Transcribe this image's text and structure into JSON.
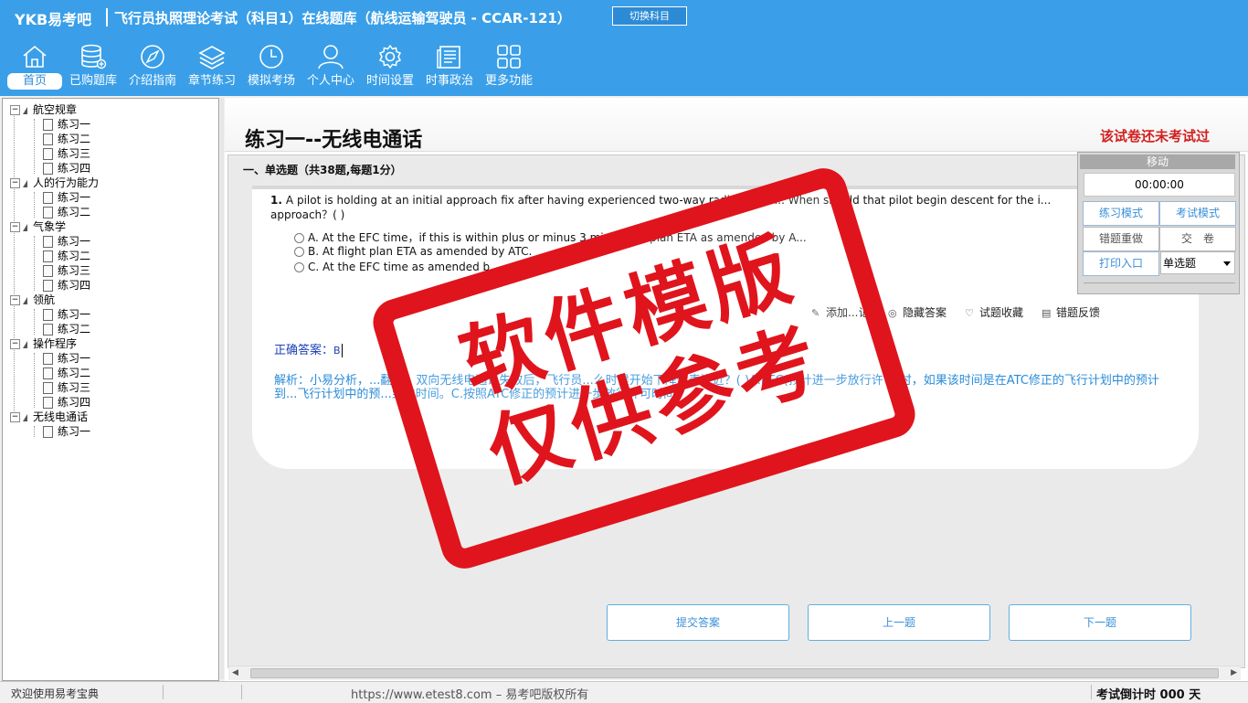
{
  "header": {
    "logo": "YKB易考吧",
    "title": "飞行员执照理论考试（科目1）在线题库（航线运输驾驶员 - CCAR-121）",
    "switch_label": "切换科目"
  },
  "nav": [
    {
      "label": "首页",
      "icon": "home-icon",
      "active": true
    },
    {
      "label": "已购题库",
      "icon": "database-icon"
    },
    {
      "label": "介绍指南",
      "icon": "compass-icon"
    },
    {
      "label": "章节练习",
      "icon": "layers-icon"
    },
    {
      "label": "模拟考场",
      "icon": "clock-icon"
    },
    {
      "label": "个人中心",
      "icon": "user-icon"
    },
    {
      "label": "时间设置",
      "icon": "gear-icon"
    },
    {
      "label": "时事政治",
      "icon": "news-icon"
    },
    {
      "label": "更多功能",
      "icon": "grid-icon"
    }
  ],
  "tree": [
    {
      "label": "航空规章",
      "children": [
        "练习一",
        "练习二",
        "练习三",
        "练习四"
      ]
    },
    {
      "label": "人的行为能力",
      "children": [
        "练习一",
        "练习二"
      ]
    },
    {
      "label": "气象学",
      "children": [
        "练习一",
        "练习二",
        "练习三",
        "练习四"
      ]
    },
    {
      "label": "领航",
      "children": [
        "练习一",
        "练习二"
      ]
    },
    {
      "label": "操作程序",
      "children": [
        "练习一",
        "练习二",
        "练习三",
        "练习四"
      ]
    },
    {
      "label": "无线电通话",
      "children": [
        "练习一"
      ]
    }
  ],
  "page": {
    "title": "练习一--无线电通话",
    "status": "该试卷还未考试过",
    "section": "一、单选题（共38题,每题1分）"
  },
  "question": {
    "number": "1.",
    "stem": "A pilot is holding at an initial approach fix after having experienced two-way radio comm... When should that pilot begin descent for the i... approach？( )",
    "options": [
      {
        "key": "A.",
        "text": "At the EFC time，if this is within plus or minus 3 minut... ... plan ETA as amended by A..."
      },
      {
        "key": "B.",
        "text": "At flight plan ETA as amended by ATC."
      },
      {
        "key": "C.",
        "text": "At the EFC time as amended b..."
      }
    ],
    "tools": [
      "添加...记",
      "隐藏答案",
      "试题收藏",
      "错题反馈"
    ],
    "answer_label": "正确答案：",
    "answer_value": "B",
    "analysis": "解析：小易分析，...翻译：双向无线电通讯失效后，飞行员...么时候开始下降仪表进近？( )A.EFC(预计进一步放行许可)时，如果该时间是在ATC修正的飞行计划中的预计到...飞行计划中的预...到达时间。C.按照ATC修正的预计进一步放行许可时间"
  },
  "actions": {
    "submit": "提交答案",
    "prev": "上一题",
    "next": "下一题"
  },
  "panel": {
    "move": "移动",
    "timer": "00:00:00",
    "practice_mode": "练习模式",
    "exam_mode": "考试模式",
    "redo_wrong": "错题重做",
    "hand_in": "交　卷",
    "print": "打印入口",
    "type_select": "单选题"
  },
  "status": {
    "welcome": "欢迎使用易考宝典",
    "copyright": "https://www.etest8.com – 易考吧版权所有",
    "countdown": "考试倒计时 000 天"
  },
  "watermark": {
    "line1": "软件模版",
    "line2": "仅供参考"
  },
  "colors": {
    "header": "#3a9fe8",
    "stamp": "#e0141c",
    "analysis": "#2a8cd8",
    "status_red": "#d21f1f"
  }
}
